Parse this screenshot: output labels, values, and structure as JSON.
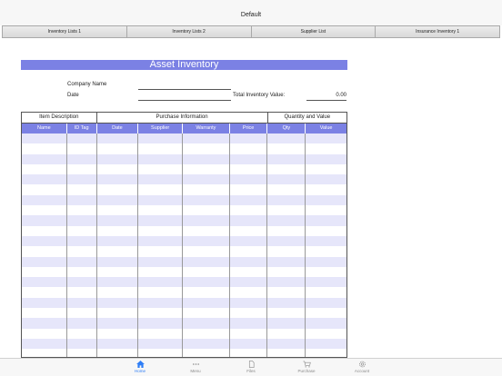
{
  "window": {
    "title": "Default"
  },
  "sheet_tabs": [
    {
      "label": "Inventory Lists 1"
    },
    {
      "label": "Inventory Lists 2"
    },
    {
      "label": "Supplier List"
    },
    {
      "label": "Insurance Inventory 1"
    }
  ],
  "document": {
    "title": "Asset Inventory",
    "company_label": "Company Name",
    "date_label": "Date",
    "total_label": "Total Inventory Value:",
    "total_value": "0.00"
  },
  "table": {
    "groups": [
      {
        "label": "Item Description"
      },
      {
        "label": "Purchase Information"
      },
      {
        "label": "Quantity and Value"
      }
    ],
    "columns": [
      {
        "label": "Name"
      },
      {
        "label": "ID Tag"
      },
      {
        "label": "Date"
      },
      {
        "label": "Supplier"
      },
      {
        "label": "Warranty"
      },
      {
        "label": "Price"
      },
      {
        "label": "Qty"
      },
      {
        "label": "Value"
      }
    ]
  },
  "tabbar": [
    {
      "label": "Home",
      "icon": "home-icon"
    },
    {
      "label": "Menu",
      "icon": "more-icon"
    },
    {
      "label": "Files",
      "icon": "file-icon"
    },
    {
      "label": "Purchase",
      "icon": "cart-icon"
    },
    {
      "label": "Account",
      "icon": "gear-icon"
    }
  ],
  "colors": {
    "header_blue": "#7b81e4",
    "row_alt": "#e6e6fa",
    "active_tab": "#2f7ef6"
  }
}
